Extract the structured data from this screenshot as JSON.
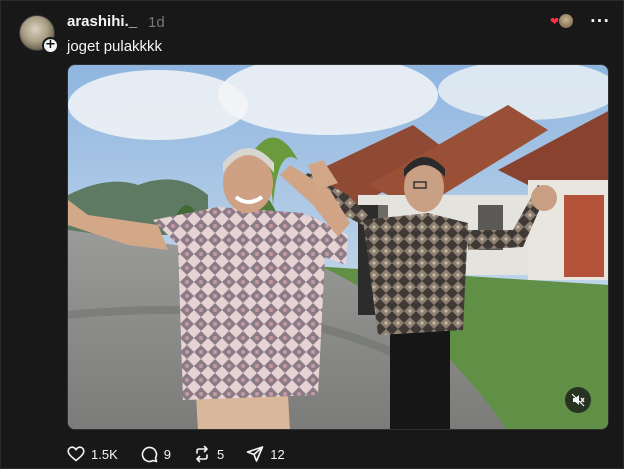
{
  "post": {
    "username": "arashihi._",
    "timestamp": "1d",
    "caption": "joget pulakkkk"
  },
  "stats": {
    "likes": "1.5K",
    "comments": "9",
    "reposts": "5",
    "shares": "12"
  },
  "icons": {
    "like": "heart-icon",
    "comment": "comment-icon",
    "repost": "repost-icon",
    "share": "send-icon",
    "more": "more-icon",
    "mute": "speaker-muted-icon",
    "follow": "plus-icon"
  },
  "colors": {
    "background": "#181818",
    "text_primary": "#f3f5f7",
    "text_secondary": "#777777",
    "like_red": "#ff3040"
  }
}
